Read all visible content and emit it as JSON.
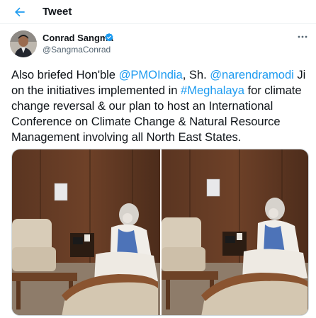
{
  "header": {
    "title": "Tweet",
    "back_icon": "arrow-left-icon"
  },
  "tweet": {
    "author_name": "Conrad Sangma",
    "author_handle": "@SangmaConrad",
    "verified_icon": "verified-badge-icon",
    "more_icon": "more-options-icon",
    "text": {
      "part1": "Also briefed Hon'ble ",
      "mention1": "@PMOIndia",
      "part2": ", Sh. ",
      "mention2": "@narendramodi",
      "part3": " Ji on the initiatives implemented in ",
      "hashtag": "#Meghalaya",
      "part4": " for climate change reversal & our plan to host an International Conference on Climate Change & Natural Resource Management involving all North East States."
    },
    "media_count": 2
  },
  "colors": {
    "link": "#1d9bf0",
    "text": "#0f1419",
    "secondary": "#536471",
    "verified": "#1d9bf0"
  }
}
